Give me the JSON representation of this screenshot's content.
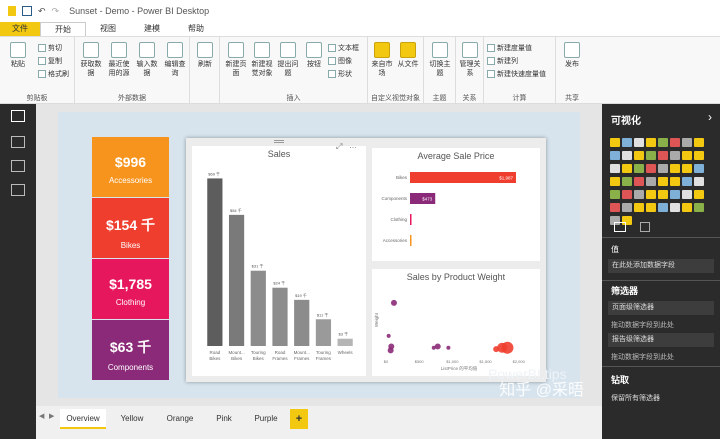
{
  "window": {
    "title": "Sunset - Demo - Power BI Desktop"
  },
  "ribbon_tabs": [
    "文件",
    "开始",
    "视图",
    "建模",
    "帮助"
  ],
  "ribbon": {
    "clipboard": {
      "paste_label": "粘贴",
      "cut_label": "剪切",
      "copy_label": "复制",
      "format_painter_label": "格式刷",
      "group_label": "剪贴板"
    },
    "external_data": {
      "get_data_label": "获取数据",
      "recent_sources_label": "最近使用的源",
      "enter_data_label": "输入数据",
      "edit_queries_label": "编辑查询",
      "group_label": "外部数据"
    },
    "refresh_label": "刷新",
    "insert": {
      "new_page_label": "新建页面",
      "new_visual_label": "新建视觉对象",
      "ask_question_label": "提出问题",
      "button_label": "按钮",
      "textbox_label": "文本框",
      "image_label": "图像",
      "shapes_label": "形状",
      "group_label": "插入"
    },
    "custom_visuals": {
      "from_market_label": "来自市场",
      "from_file_label": "从文件",
      "group_label": "自定义视觉对象"
    },
    "themes": {
      "switch_theme_label": "切换主题",
      "group_label": "主题"
    },
    "relationships": {
      "manage_label": "管理关系",
      "group_label": "关系"
    },
    "calculations": {
      "new_measure_label": "新建度量值",
      "new_column_label": "新建列",
      "new_quick_measure_label": "新建快速度量值",
      "group_label": "计算"
    },
    "share": {
      "publish_label": "发布",
      "group_label": "共享"
    }
  },
  "kpi_tiles": [
    {
      "value": "$996",
      "label": "Accessories",
      "color": "#f7941d"
    },
    {
      "value": "$154 千",
      "label": "Bikes",
      "color": "#ef3e2d"
    },
    {
      "value": "$1,785",
      "label": "Clothing",
      "color": "#e6175c"
    },
    {
      "value": "$63 千",
      "label": "Components",
      "color": "#8b2a78"
    }
  ],
  "chart_data": [
    {
      "type": "bar",
      "title": "Sales",
      "categories": [
        "Road Bikes",
        "Mount... Bikes",
        "Touring Bikes",
        "Road Frames",
        "Mount... Frames",
        "Touring Frames",
        "Wheels"
      ],
      "values": [
        69,
        54,
        31,
        24,
        19,
        11,
        3
      ],
      "data_labels": [
        "$69 千",
        "$54 千",
        "$31 千",
        "$24 千",
        "$19 千",
        "$11 千",
        "$3 千"
      ],
      "bar_colors": [
        "#5d5d5d",
        "#7a7a7a",
        "#8c8c8c",
        "#8c8c8c",
        "#8c8c8c",
        "#9a9a9a",
        "#b5b5b5"
      ]
    },
    {
      "type": "bar",
      "orientation": "horizontal",
      "title": "Average Sale Price",
      "categories": [
        "Bikes",
        "Components",
        "Clothing",
        "Accessories"
      ],
      "values": [
        1987,
        473,
        25,
        10
      ],
      "data_labels": [
        "$1,987",
        "$473",
        "",
        ""
      ],
      "bar_colors": [
        "#ef3e2d",
        "#8b2a78",
        "#e6175c",
        "#f7941d"
      ]
    },
    {
      "type": "scatter",
      "title": "Sales by Product Weight",
      "xlabel": "ListPrice 的平均值",
      "ylabel": "Weight",
      "x_ticks": [
        "$0",
        "$500",
        "$1,000",
        "$1,500",
        "$2,000"
      ],
      "xlim": [
        0,
        2200
      ],
      "ylim": [
        0,
        100
      ],
      "series": [
        {
          "points": [
            {
              "x": 120,
              "y": 82,
              "r": 3
            },
            {
              "x": 40,
              "y": 32,
              "r": 2
            },
            {
              "x": 80,
              "y": 16,
              "r": 3
            },
            {
              "x": 70,
              "y": 10,
              "r": 3
            },
            {
              "x": 780,
              "y": 16,
              "r": 3
            },
            {
              "x": 940,
              "y": 14,
              "r": 2
            },
            {
              "x": 720,
              "y": 14,
              "r": 2
            },
            {
              "x": 1750,
              "y": 14,
              "r": 5
            },
            {
              "x": 1830,
              "y": 14,
              "r": 6
            },
            {
              "x": 1660,
              "y": 12,
              "r": 3
            }
          ],
          "color": "#8b2a78",
          "highlight_color": "#ef3e2d"
        }
      ]
    }
  ],
  "visualizations_pane": {
    "title": "可视化",
    "values_label": "值",
    "values_hint": "在此处添加数据字段",
    "filters_title": "筛选器",
    "page_filters_label": "页面级筛选器",
    "page_filters_hint": "拖动数据字段到此处",
    "report_filters_label": "报告级筛选器",
    "report_filters_hint": "拖动数据字段到此处",
    "drillthrough_title": "钻取",
    "keep_all_filters_label": "保留所有筛选器"
  },
  "watermarks": {
    "powerbi_tips": "PowerBI.tips",
    "zhihu": "知乎 @采晤"
  },
  "page_tabs": [
    {
      "label": "Overview",
      "active": true
    },
    {
      "label": "Yellow",
      "active": false
    },
    {
      "label": "Orange",
      "active": false
    },
    {
      "label": "Pink",
      "active": false
    },
    {
      "label": "Purple",
      "active": false
    }
  ],
  "add_page_label": "+"
}
